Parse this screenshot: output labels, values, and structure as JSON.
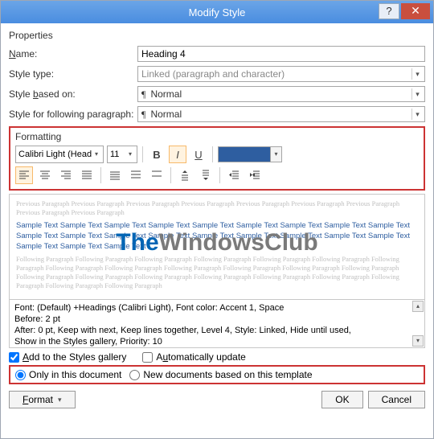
{
  "titlebar": {
    "title": "Modify Style",
    "help": "?",
    "close": "✕"
  },
  "sections": {
    "properties": "Properties",
    "formatting": "Formatting"
  },
  "labels": {
    "name": "Name:",
    "style_type": "Style type:",
    "based_on": "Style based on:",
    "following": "Style for following paragraph:"
  },
  "values": {
    "name": "Heading 4",
    "style_type": "Linked (paragraph and character)",
    "based_on": "Normal",
    "following": "Normal"
  },
  "formatting": {
    "font": "Calibri Light (Head",
    "size": "11",
    "bold": "B",
    "italic": "I",
    "underline": "U"
  },
  "preview": {
    "gray_prev": "Previous Paragraph Previous Paragraph Previous Paragraph Previous Paragraph Previous Paragraph Previous Paragraph Previous Paragraph Previous Paragraph Previous Paragraph",
    "blue": "Sample Text Sample Text Sample Text Sample Text Sample Text Sample Text Sample Text Sample Text Sample Text Sample Text Sample Text Sample Text Sample Text Sample Text Sample Text Sample Text Sample Text Sample Text Sample Text Sample Text Sample Text",
    "gray_next": "Following Paragraph Following Paragraph Following Paragraph Following Paragraph Following Paragraph Following Paragraph Following Paragraph Following Paragraph Following Paragraph Following Paragraph Following Paragraph Following Paragraph Following Paragraph Following Paragraph Following Paragraph Following Paragraph Following Paragraph Following Paragraph Following Paragraph Following Paragraph Following Paragraph Following Paragraph",
    "wm1": "The",
    "wm2": "WindowsClub"
  },
  "desc": {
    "l1": "Font: (Default) +Headings (Calibri Light), Font color: Accent 1, Space",
    "l2": "   Before:  2 pt",
    "l3": "   After:  0 pt, Keep with next, Keep lines together, Level 4, Style: Linked, Hide until used,",
    "l4": "Show in the Styles gallery, Priority: 10"
  },
  "checks": {
    "add_gallery": "Add to the Styles gallery",
    "auto_update": "Automatically update"
  },
  "radios": {
    "only_doc": "Only in this document",
    "new_docs": "New documents based on this template"
  },
  "buttons": {
    "format": "Format",
    "ok": "OK",
    "cancel": "Cancel"
  }
}
